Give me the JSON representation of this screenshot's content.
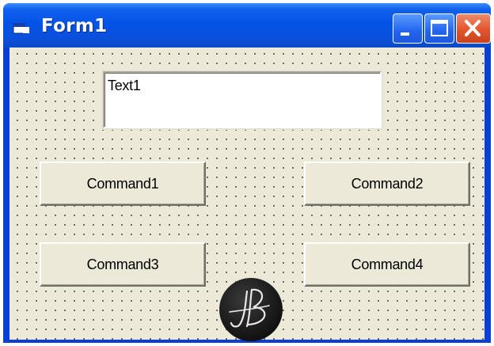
{
  "window": {
    "title": "Form1",
    "icons": {
      "app": "app-window-icon",
      "minimize": "minimize-icon",
      "maximize": "maximize-icon",
      "close": "close-icon"
    },
    "colors": {
      "titlebar": "#0553e6",
      "form_background": "#ece9d8",
      "close_button": "#e2552e"
    }
  },
  "form": {
    "text1": {
      "value": "Text1"
    },
    "buttons": {
      "command1": "Command1",
      "command2": "Command2",
      "command3": "Command3",
      "command4": "Command4"
    },
    "watermark": {
      "text": "JB"
    }
  }
}
